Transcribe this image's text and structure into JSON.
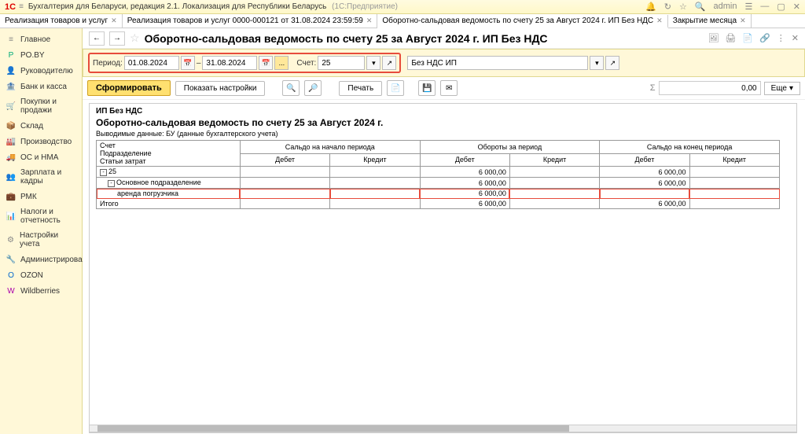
{
  "titlebar": {
    "logo": "1С",
    "title": "Бухгалтерия для Беларуси, редакция 2.1. Локализация для Республики Беларусь",
    "subtitle": "(1С:Предприятие)",
    "user": "admin"
  },
  "tabs": [
    {
      "label": "Реализация товаров и услуг"
    },
    {
      "label": "Реализация товаров и услуг 0000-000121 от 31.08.2024 23:59:59"
    },
    {
      "label": "Оборотно-сальдовая ведомость по счету 25 за Август 2024 г. ИП Без НДС",
      "active": true
    },
    {
      "label": "Закрытие месяца"
    }
  ],
  "sidebar": [
    {
      "icon": "≡",
      "label": "Главное",
      "color": "#888"
    },
    {
      "icon": "P",
      "label": "PO.BY",
      "color": "#0a7"
    },
    {
      "icon": "👤",
      "label": "Руководителю",
      "color": "#888"
    },
    {
      "icon": "🏦",
      "label": "Банк и касса",
      "color": "#888"
    },
    {
      "icon": "🛒",
      "label": "Покупки и продажи",
      "color": "#888"
    },
    {
      "icon": "📦",
      "label": "Склад",
      "color": "#888"
    },
    {
      "icon": "🏭",
      "label": "Производство",
      "color": "#888"
    },
    {
      "icon": "🚚",
      "label": "ОС и НМА",
      "color": "#888"
    },
    {
      "icon": "👥",
      "label": "Зарплата и кадры",
      "color": "#888"
    },
    {
      "icon": "💼",
      "label": "РМК",
      "color": "#888"
    },
    {
      "icon": "📊",
      "label": "Налоги и отчетность",
      "color": "#888"
    },
    {
      "icon": "⚙",
      "label": "Настройки учета",
      "color": "#888"
    },
    {
      "icon": "🔧",
      "label": "Администрирование",
      "color": "#888"
    },
    {
      "icon": "O",
      "label": "OZON",
      "color": "#06c"
    },
    {
      "icon": "W",
      "label": "Wildberries",
      "color": "#a0a"
    }
  ],
  "page": {
    "title": "Оборотно-сальдовая ведомость по счету 25 за Август 2024 г. ИП Без НДС"
  },
  "params": {
    "period_label": "Период:",
    "date_from": "01.08.2024",
    "date_to": "31.08.2024",
    "dash": "–",
    "dots": "...",
    "account_label": "Счет:",
    "account": "25",
    "org": "Без НДС ИП"
  },
  "toolbar": {
    "form": "Сформировать",
    "settings": "Показать настройки",
    "print": "Печать",
    "sum_icon": "Σ",
    "sum": "0,00",
    "more": "Еще"
  },
  "report": {
    "org": "ИП Без НДС",
    "title": "Оборотно-сальдовая ведомость по счету 25 за Август 2024 г.",
    "meta": "Выводимые данные:   БУ (данные бухгалтерского учета)",
    "headers": {
      "col1a": "Счет",
      "col1b": "Подразделение",
      "col1c": "Статьи затрат",
      "g1": "Сальдо на начало периода",
      "g2": "Обороты за период",
      "g3": "Сальдо на конец периода",
      "d": "Дебет",
      "k": "Кредит"
    },
    "rows": [
      {
        "label": "25",
        "indent": 0,
        "tree": "-",
        "ob_d": "6 000,00",
        "sk_d": "6 000,00"
      },
      {
        "label": "Основное подразделение",
        "indent": 1,
        "tree": "-",
        "ob_d": "6 000,00",
        "sk_d": "6 000,00"
      },
      {
        "label": "аренда погрузчика",
        "indent": 2,
        "hl": true,
        "ob_d": "6 000,00"
      },
      {
        "label": "Итого",
        "indent": 0,
        "ob_d": "6 000,00",
        "sk_d": "6 000,00"
      }
    ]
  }
}
